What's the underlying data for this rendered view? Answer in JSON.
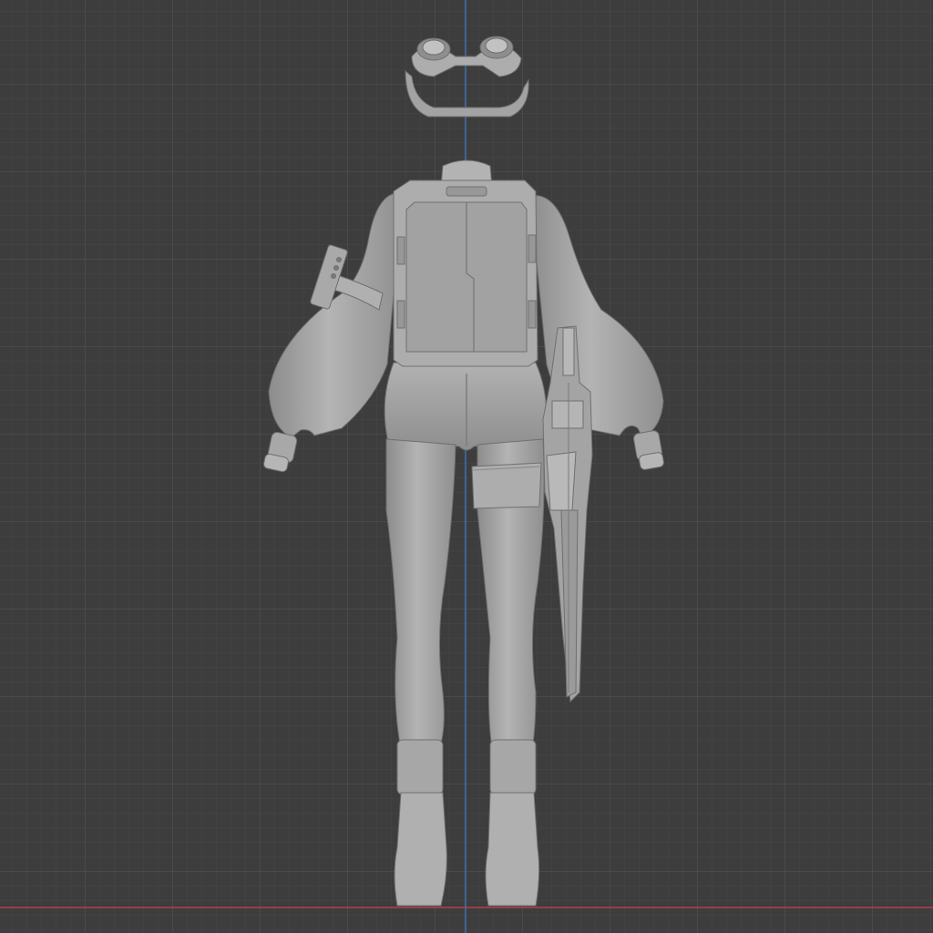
{
  "viewport": {
    "view": "back-orthographic",
    "background_color": "#3d3d3d",
    "grid_minor_color": "#474747",
    "grid_major_color": "#505050",
    "axis_z_color": "#3f6fb0",
    "axis_x_color": "#b0424e",
    "model_color": "#a6a6a6",
    "model_shadow_color": "#8a8a8a",
    "model_highlight_color": "#bdbdbd",
    "visible_text": []
  },
  "model": {
    "parts": [
      "goggles",
      "backpack",
      "left-arm",
      "right-arm",
      "hips",
      "left-leg",
      "right-leg",
      "left-boot",
      "right-boot",
      "thigh-strap",
      "sheathed-weapon",
      "arm-band"
    ]
  }
}
